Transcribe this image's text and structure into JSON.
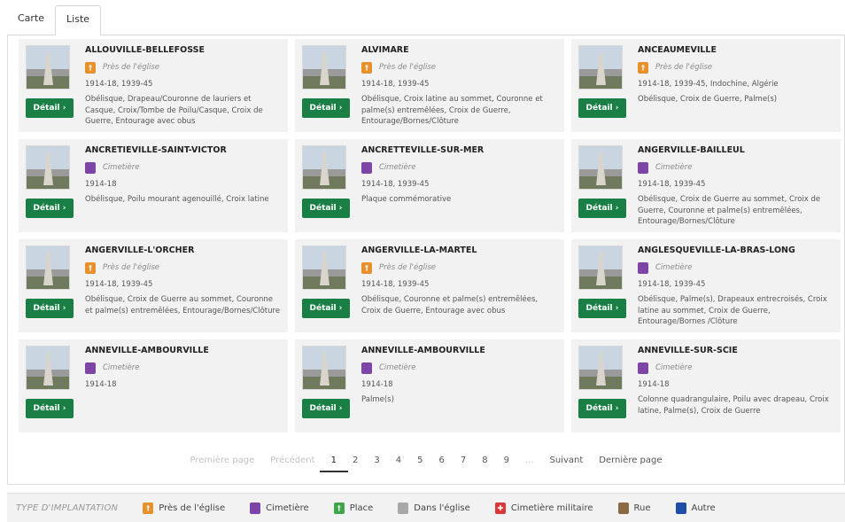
{
  "tabs": [
    {
      "label": "Carte",
      "active": false
    },
    {
      "label": "Liste",
      "active": true
    }
  ],
  "detail_label": "Détail ›",
  "cards": [
    {
      "name": "ALLOUVILLE-BELLEFOSSE",
      "type": "Près de l'église",
      "type_key": "eglise",
      "years": "1914-18, 1939-45",
      "description": "Obélisque, Drapeau/Couronne de lauriers et Casque, Croix/Tombe de Poilu/Casque, Croix de Guerre, Entourage avec obus"
    },
    {
      "name": "ALVIMARE",
      "type": "Près de l'église",
      "type_key": "eglise",
      "years": "1914-18, 1939-45",
      "description": "Obélisque, Croix latine au sommet, Couronne et palme(s) entremêlées, Croix de Guerre, Entourage/Bornes/Clôture"
    },
    {
      "name": "ANCEAUMEVILLE",
      "type": "Près de l'église",
      "type_key": "eglise",
      "years": "1914-18, 1939-45, Indochine, Algérie",
      "description": "Obélisque, Croix de Guerre, Palme(s)"
    },
    {
      "name": "ANCRETIÉVILLE-SAINT-VICTOR",
      "type": "Cimetière",
      "type_key": "cimetiere",
      "years": "1914-18",
      "description": "Obélisque, Poilu mourant agenouillé, Croix latine"
    },
    {
      "name": "ANCRETTEVILLE-SUR-MER",
      "type": "Cimetière",
      "type_key": "cimetiere",
      "years": "1914-18, 1939-45",
      "description": "Plaque commémorative"
    },
    {
      "name": "ANGERVILLE-BAILLEUL",
      "type": "Cimetière",
      "type_key": "cimetiere",
      "years": "1914-18, 1939-45",
      "description": "Obélisque, Croix de Guerre au sommet, Croix de Guerre, Couronne et palme(s) entremêlées, Entourage/Bornes/Clôture"
    },
    {
      "name": "ANGERVILLE-L'ORCHER",
      "type": "Près de l'église",
      "type_key": "eglise",
      "years": "1914-18, 1939-45",
      "description": "Obélisque, Croix de Guerre au sommet, Couronne et palme(s) entremêlées, Entourage/Bornes/Clôture"
    },
    {
      "name": "ANGERVILLE-LA-MARTEL",
      "type": "Près de l'église",
      "type_key": "eglise",
      "years": "1914-18, 1939-45",
      "description": "Obélisque, Couronne et palme(s) entremêlées, Croix de Guerre, Entourage avec obus"
    },
    {
      "name": "ANGLESQUEVILLE-LA-BRAS-LONG",
      "type": "Cimetière",
      "type_key": "cimetiere",
      "years": "1914-18, 1939-45",
      "description": "Obélisque, Palme(s), Drapeaux entrecroisés, Croix latine au sommet, Croix de Guerre, Entourage/Bornes /Clôture"
    },
    {
      "name": "ANNEVILLE-AMBOURVILLE",
      "type": "Cimetière",
      "type_key": "cimetiere",
      "years": "1914-18",
      "description": ""
    },
    {
      "name": "ANNEVILLE-AMBOURVILLE",
      "type": "Cimetière",
      "type_key": "cimetiere",
      "years": "1914-18",
      "description": "Palme(s)"
    },
    {
      "name": "ANNEVILLE-SUR-SCIE",
      "type": "Cimetière",
      "type_key": "cimetiere",
      "years": "1914-18",
      "description": "Colonne quadrangulaire, Poilu avec drapeau, Croix latine, Palme(s), Croix de Guerre"
    }
  ],
  "pagination": {
    "first": "Première page",
    "prev": "Précédent",
    "pages": [
      "1",
      "2",
      "3",
      "4",
      "5",
      "6",
      "7",
      "8",
      "9",
      "..."
    ],
    "current": "1",
    "next": "Suivant",
    "last": "Dernière page"
  },
  "legend": {
    "title": "TYPE D'IMPLANTATION",
    "items": [
      {
        "label": "Près de l'église",
        "type_key": "eglise",
        "color": "#e8902b"
      },
      {
        "label": "Cimetière",
        "type_key": "cimetiere",
        "color": "#7d46a6"
      },
      {
        "label": "Place",
        "type_key": "place",
        "color": "#3ea648"
      },
      {
        "label": "Dans l'église",
        "type_key": "dans",
        "color": "#a8a8a8"
      },
      {
        "label": "Cimetière militaire",
        "type_key": "militaire",
        "color": "#d83a3a"
      },
      {
        "label": "Rue",
        "type_key": "rue",
        "color": "#8a6a45"
      },
      {
        "label": "Autre",
        "type_key": "autre",
        "color": "#1f4ea8"
      }
    ]
  },
  "colors": {
    "detail_button": "#1a7f45",
    "card_background": "#f2f2f2"
  }
}
